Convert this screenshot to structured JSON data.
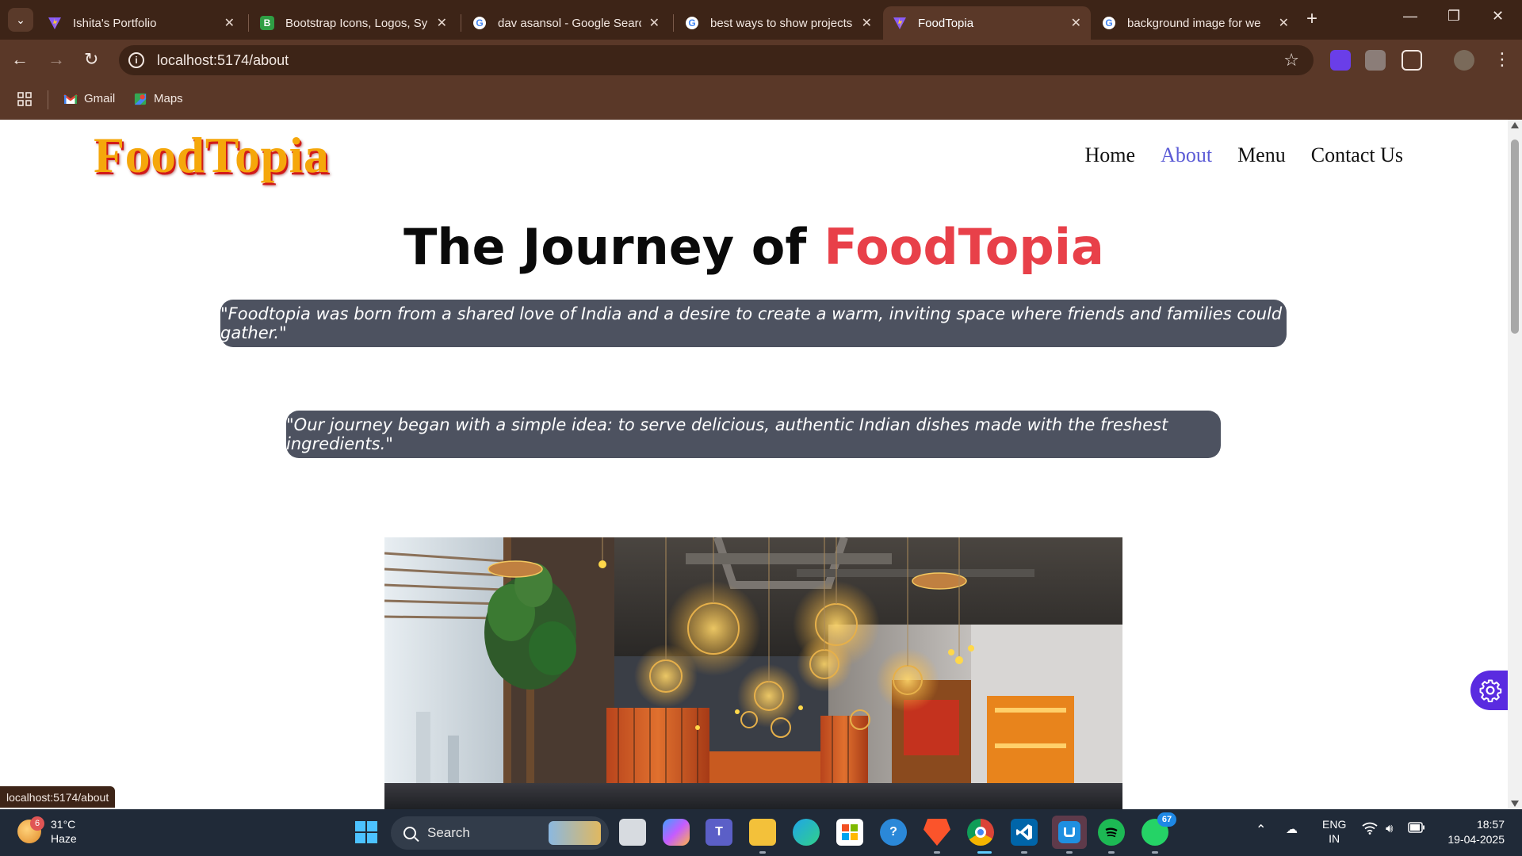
{
  "browser": {
    "tabs": [
      {
        "title": "Ishita's Portfolio",
        "favicon": "vite-icon",
        "active": false
      },
      {
        "title": "Bootstrap Icons, Logos, Sy",
        "favicon": "bootstrap-icon",
        "active": false
      },
      {
        "title": "dav asansol - Google Searc",
        "favicon": "google-icon",
        "active": false
      },
      {
        "title": "best ways to show projects",
        "favicon": "google-icon",
        "active": false
      },
      {
        "title": "FoodTopia",
        "favicon": "vite-icon",
        "active": true
      },
      {
        "title": "background image for we",
        "favicon": "google-icon",
        "active": false
      }
    ],
    "url": "localhost:5174/about",
    "bookmarks": [
      {
        "label": "Gmail",
        "icon": "gmail-icon"
      },
      {
        "label": "Maps",
        "icon": "maps-icon"
      }
    ],
    "status_url": "localhost:5174/about",
    "colors": {
      "frame": "#3d2417",
      "toolbar": "#5a3828"
    }
  },
  "site": {
    "logo": "FoodTopia",
    "nav": [
      {
        "label": "Home",
        "active": false
      },
      {
        "label": "About",
        "active": true
      },
      {
        "label": "Menu",
        "active": false
      },
      {
        "label": "Contact Us",
        "active": false
      }
    ],
    "heading_prefix": "The Journey of",
    "heading_accent": "FoodTopia",
    "quote_1": "\"Foodtopia was born from a shared love of India and a desire to create a warm, inviting space where friends and families could gather.\"",
    "quote_2": "\"Our journey began with a simple idea: to serve delicious, authentic Indian dishes made with the freshest ingredients.\"",
    "image_subject": "restaurant-interior-photo",
    "colors": {
      "accent": "#e84049",
      "logo": "#f5a70b",
      "nav_active": "#5b5bd6",
      "quote_bg": "#4d5260",
      "fab": "#5a2be0"
    }
  },
  "taskbar": {
    "weather": {
      "temp": "31°C",
      "condition": "Haze",
      "badge": "6"
    },
    "search_placeholder": "Search",
    "whatsapp_badge": "67",
    "language": {
      "line1": "ENG",
      "line2": "IN"
    },
    "clock": {
      "time": "18:57",
      "date": "19-04-2025"
    }
  }
}
